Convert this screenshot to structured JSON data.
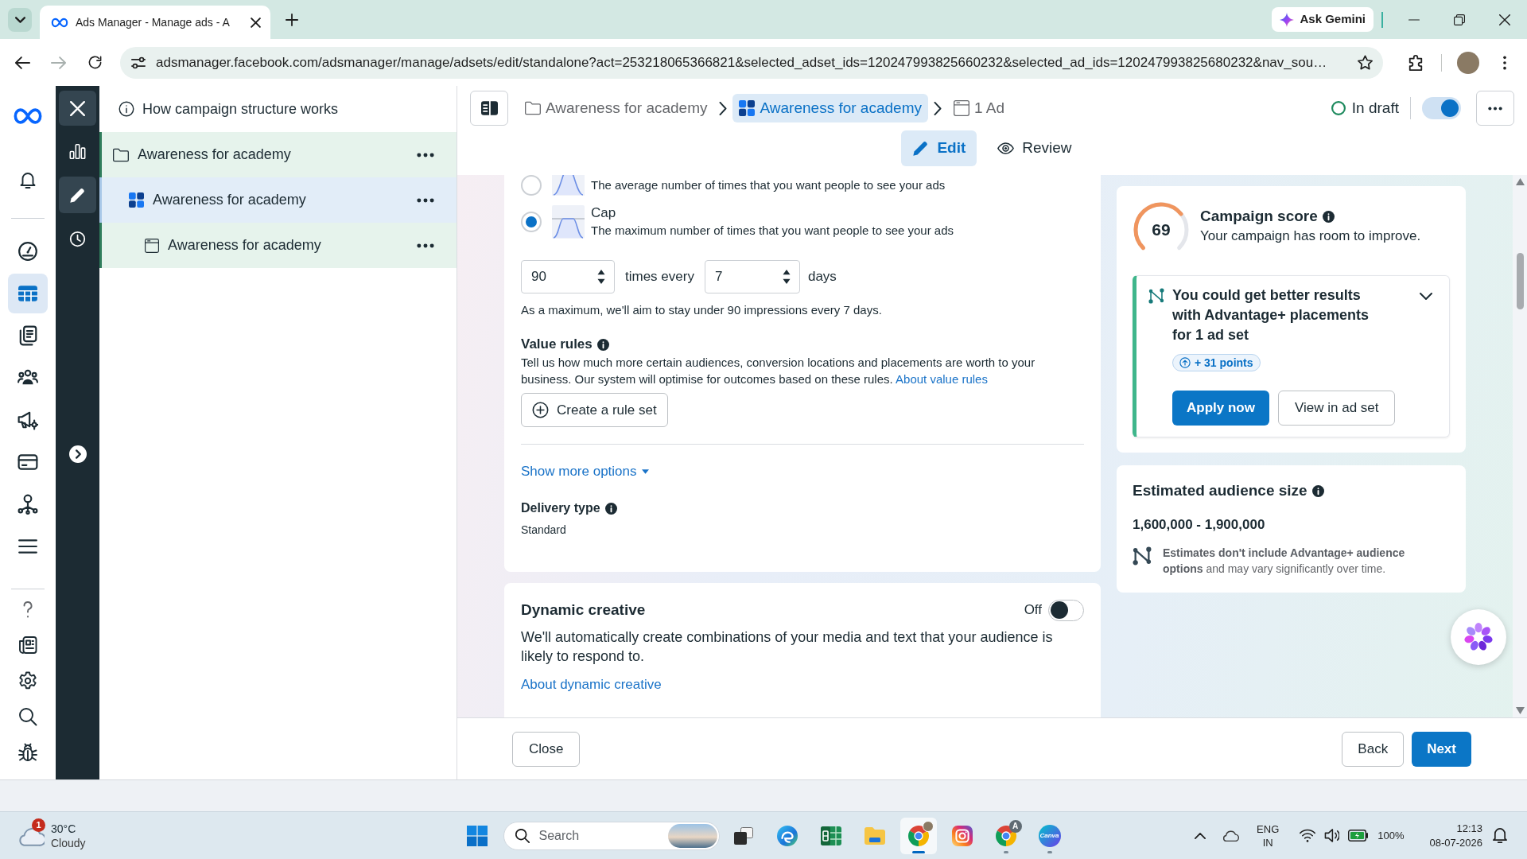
{
  "browser": {
    "tabs": [
      {
        "title": "Ads Manager - Manage ads - A",
        "selected": true
      }
    ],
    "gemini_button": "Ask Gemini",
    "forward_disabled": true,
    "url": "adsmanager.facebook.com/adsmanager/manage/adsets/edit/standalone?act=253218065366821&selected_adset_ids=120247993825660232&selected_ad_ids=120247993825680232&nav_sou…"
  },
  "nav": {
    "items": [
      {
        "selected": false
      },
      {
        "selected": true
      },
      {
        "selected": false
      },
      {
        "selected": false
      },
      {
        "selected": false
      },
      {
        "selected": false
      },
      {
        "selected": false
      },
      {
        "selected": false
      }
    ]
  },
  "rail": {
    "items": [
      {
        "selected": false
      },
      {
        "selected": true
      },
      {
        "selected": false
      }
    ]
  },
  "structure": {
    "help_link": "How campaign structure works",
    "tree": [
      {
        "label": "Awareness for academy",
        "selected": false,
        "children": [
          {
            "label": "Awareness for academy",
            "selected": true,
            "children": [
              {
                "label": "Awareness for academy",
                "selected": false
              }
            ]
          }
        ]
      }
    ]
  },
  "header": {
    "breadcrumbs": [
      {
        "label": "Awareness for academy",
        "selected": false
      },
      {
        "label": "Awareness for academy",
        "selected": true
      },
      {
        "label": "1 Ad",
        "selected": false
      }
    ],
    "status": "In draft",
    "status_toggle": {
      "on": true
    },
    "modes": [
      {
        "label": "Edit",
        "selected": true
      },
      {
        "label": "Review",
        "selected": false
      }
    ]
  },
  "frequency": {
    "options": [
      {
        "description": "The average number of times that you want people to see your ads",
        "selected": false
      },
      {
        "label": "Cap",
        "description": "The maximum number of times that you want people to see your ads",
        "selected": true
      }
    ],
    "times_value": "90",
    "times_label": "times every",
    "days_value": "7",
    "days_label": "days",
    "note": "As a maximum, we'll aim to stay under 90 impressions every 7 days."
  },
  "value_rules": {
    "title": "Value rules",
    "text": "Tell us how much more certain audiences, conversion locations and placements are worth to your business. Our system will optimise for outcomes based on these rules.",
    "link": "About value rules",
    "button": "Create a rule set"
  },
  "show_more": "Show more options",
  "delivery_type": {
    "title": "Delivery type",
    "value": "Standard"
  },
  "dynamic_creative": {
    "title": "Dynamic creative",
    "toggle_label": "Off",
    "on": false,
    "text": "We'll automatically create combinations of your media and text that your audience is likely to respond to.",
    "link": "About dynamic creative"
  },
  "campaign_score": {
    "score": "69",
    "title": "Campaign score",
    "subtitle": "Your campaign has room to improve.",
    "recommendation": {
      "text": "You could get better results with Advantage+ placements for 1 ad set",
      "points": "+ 31 points",
      "expanded": false,
      "buttons": [
        {
          "label": "Apply now",
          "kind": "primary"
        },
        {
          "label": "View in ad set",
          "kind": "secondary"
        }
      ]
    }
  },
  "audience": {
    "title": "Estimated audience size",
    "range": "1,600,000 - 1,900,000",
    "note": "**Estimates don't include Advantage+ audience options** and may vary significantly over time."
  },
  "footer": {
    "close": "Close",
    "back": "Back",
    "next": "Next"
  },
  "taskbar": {
    "weather": {
      "alert_count": "1",
      "temperature": "30°C",
      "condition": "Cloudy"
    },
    "search_placeholder": "Search",
    "apps": [
      {
        "selected": false,
        "running": false
      },
      {
        "selected": false,
        "running": false
      },
      {
        "selected": false,
        "running": false
      },
      {
        "selected": false,
        "running": false
      },
      {
        "selected": true,
        "running": true
      },
      {
        "selected": false,
        "running": false
      },
      {
        "selected": false,
        "running": true,
        "badge": "A"
      },
      {
        "selected": false,
        "running": true,
        "label": "Canva"
      }
    ],
    "language": "ENG",
    "region": "IN",
    "battery": "100%",
    "time": "12:13",
    "date": "08-07-2026"
  }
}
